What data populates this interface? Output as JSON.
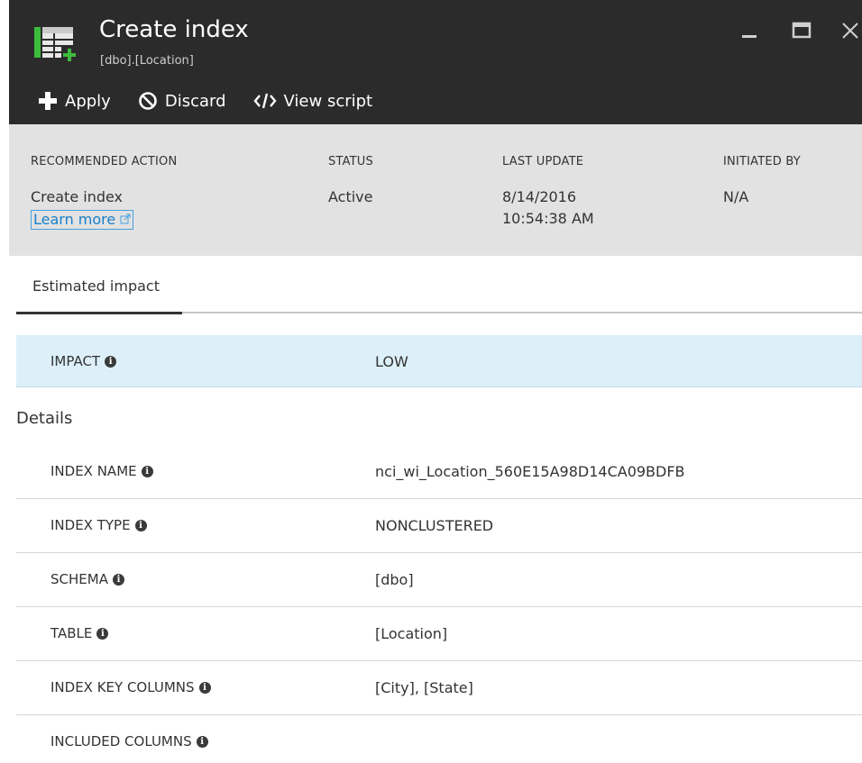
{
  "header": {
    "title": "Create index",
    "subtitle": "[dbo].[Location]",
    "window": {
      "minimize": "—",
      "close": "✕"
    }
  },
  "toolbar": {
    "apply_label": "Apply",
    "discard_label": "Discard",
    "view_script_label": "View script"
  },
  "infobar": {
    "recommended_action_header": "RECOMMENDED ACTION",
    "recommended_action_value": "Create index",
    "learn_more": "Learn more",
    "status_header": "STATUS",
    "status_value": "Active",
    "last_update_header": "LAST UPDATE",
    "last_update_date": "8/14/2016",
    "last_update_time": "10:54:38 AM",
    "initiated_by_header": "INITIATED BY",
    "initiated_by_value": "N/A"
  },
  "tabs": [
    {
      "label": "Estimated impact"
    }
  ],
  "impact": {
    "label": "IMPACT",
    "value": "LOW"
  },
  "details": {
    "heading": "Details",
    "rows": [
      {
        "label": "INDEX NAME",
        "value": "nci_wi_Location_560E15A98D14CA09BDFB"
      },
      {
        "label": "INDEX TYPE",
        "value": "NONCLUSTERED"
      },
      {
        "label": "SCHEMA",
        "value": "[dbo]"
      },
      {
        "label": "TABLE",
        "value": "[Location]"
      },
      {
        "label": "INDEX KEY COLUMNS",
        "value": "[City], [State]"
      },
      {
        "label": "INCLUDED COLUMNS",
        "value": ""
      }
    ]
  },
  "colors": {
    "header_bg": "#2b2b2b",
    "infobar_bg": "#e2e2e2",
    "impact_bg": "#ddf0fa",
    "link": "#1a7fc9",
    "icon_green": "#3dbb3d"
  }
}
